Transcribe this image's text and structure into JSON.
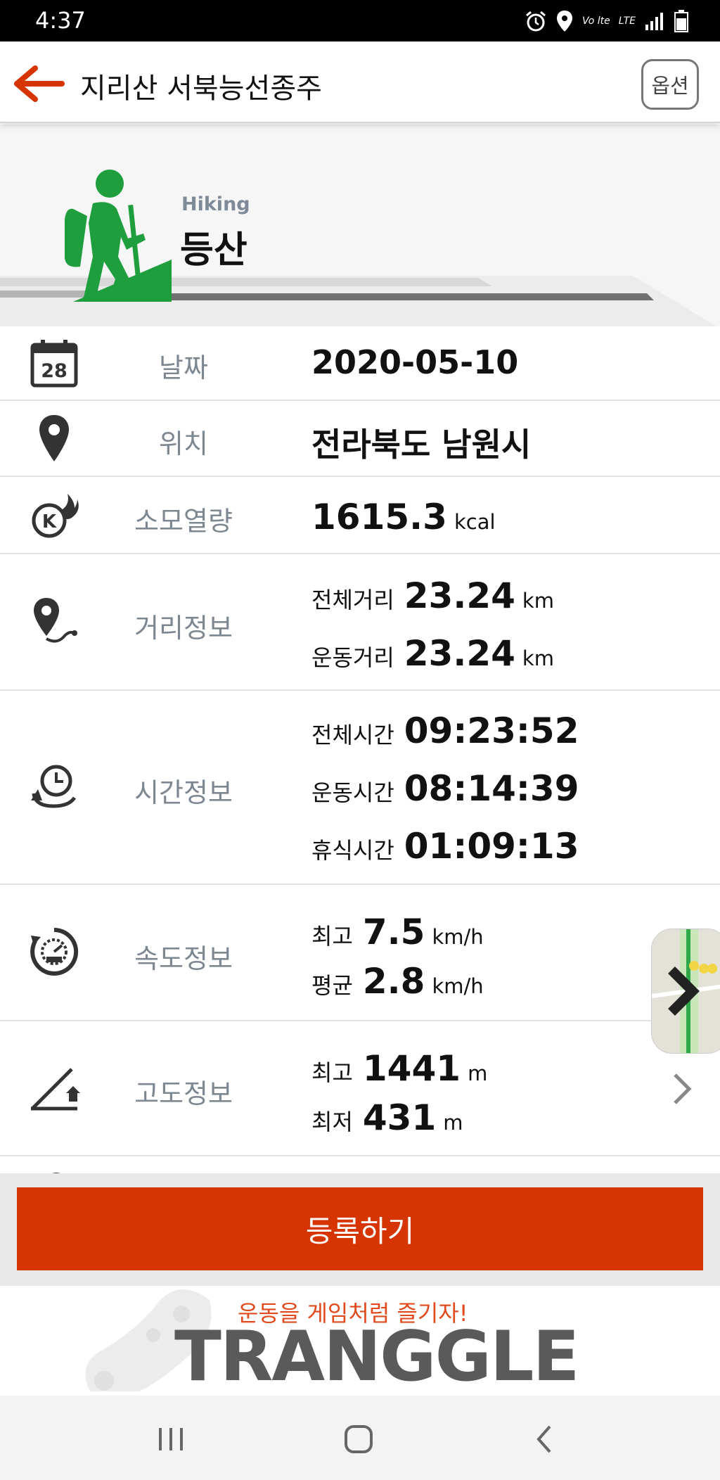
{
  "status_bar": {
    "time": "4:37",
    "network_label": "LTE",
    "volte_label": "Vo lte"
  },
  "header": {
    "title": "지리산 서북능선종주",
    "option_label": "옵션"
  },
  "activity": {
    "type_en": "Hiking",
    "type_ko": "등산"
  },
  "rows": {
    "date": {
      "label": "날짜",
      "value": "2020-05-10",
      "icon_day": "28"
    },
    "location": {
      "label": "위치",
      "value": "전라북도 남원시"
    },
    "calories": {
      "label": "소모열량",
      "value": "1615.3",
      "unit": "kcal"
    },
    "distance": {
      "label": "거리정보",
      "total_label": "전체거리",
      "total_value": "23.24",
      "total_unit": "km",
      "moving_label": "운동거리",
      "moving_value": "23.24",
      "moving_unit": "km"
    },
    "time": {
      "label": "시간정보",
      "total_label": "전체시간",
      "total_value": "09:23:52",
      "moving_label": "운동시간",
      "moving_value": "08:14:39",
      "rest_label": "휴식시간",
      "rest_value": "01:09:13"
    },
    "speed": {
      "label": "속도정보",
      "max_label": "최고",
      "max_value": "7.5",
      "max_unit": "km/h",
      "avg_label": "평균",
      "avg_value": "2.8",
      "avg_unit": "km/h"
    },
    "altitude": {
      "label": "고도정보",
      "max_label": "최고",
      "max_value": "1441",
      "max_unit": "m",
      "min_label": "최저",
      "min_value": "431",
      "min_unit": "m"
    }
  },
  "register_label": "등록하기",
  "banner": {
    "slogan": "운동을 게임처럼 즐기자!",
    "brand": "TRANGGLE"
  },
  "colors": {
    "accent": "#D63400",
    "hiker_green": "#1F9E3E",
    "label_gray": "#7D8792"
  }
}
